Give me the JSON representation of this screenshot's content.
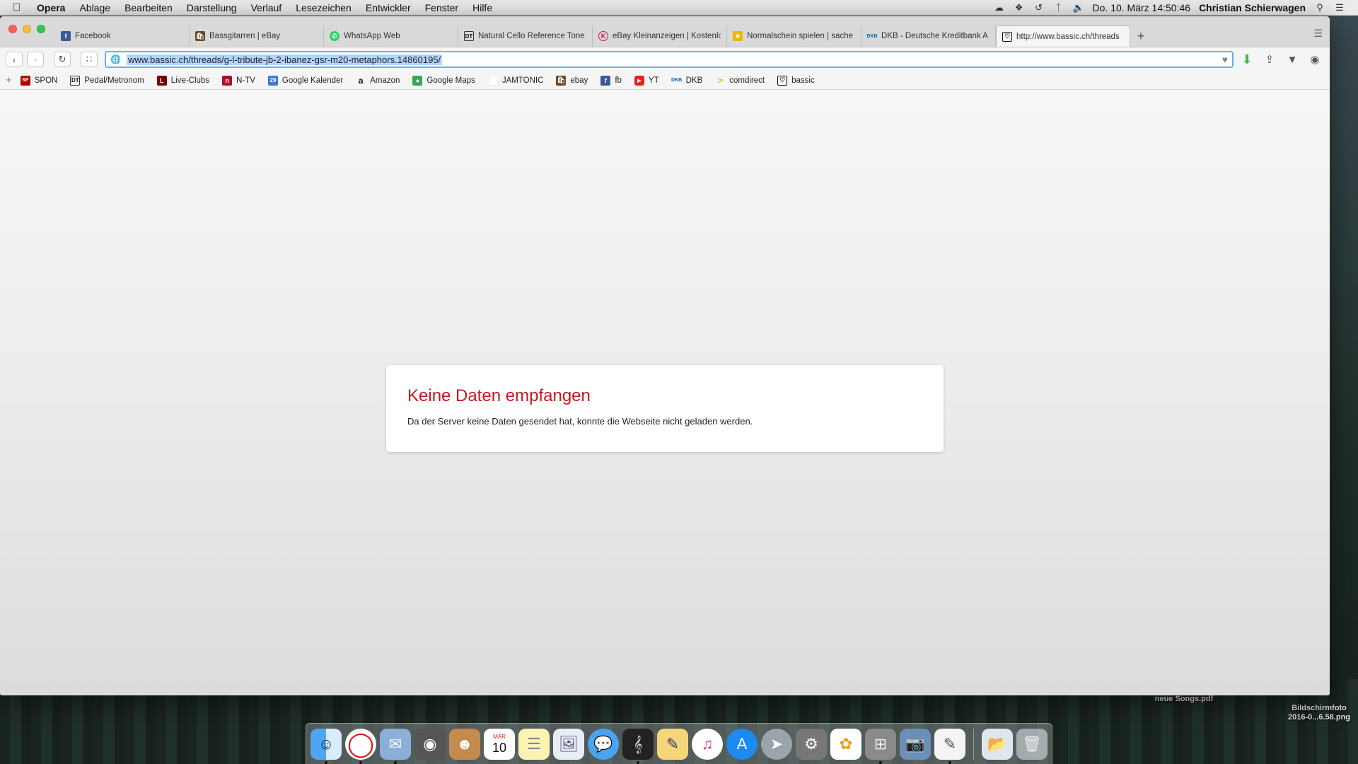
{
  "menubar": {
    "app": "Opera",
    "items": [
      "Ablage",
      "Bearbeiten",
      "Darstellung",
      "Verlauf",
      "Lesezeichen",
      "Entwickler",
      "Fenster",
      "Hilfe"
    ],
    "clock": "Do. 10. März  14:50:46",
    "user": "Christian Schierwagen"
  },
  "tabs": [
    {
      "label": "Facebook",
      "fav": "f",
      "fav_color": "#3b5998"
    },
    {
      "label": "Bassgitarren | eBay",
      "fav": "",
      "fav_color": "#6a4a2a"
    },
    {
      "label": "WhatsApp Web",
      "fav": "",
      "fav_color": "#25d366"
    },
    {
      "label": "Natural Cello Reference Tone",
      "fav": "DT",
      "fav_color": "#ffffff"
    },
    {
      "label": "eBay Kleinanzeigen | Kostenlo",
      "fav": "K",
      "fav_color": "#ffffff"
    },
    {
      "label": "Normalschein spielen | sache",
      "fav": "",
      "fav_color": "#f0b400"
    },
    {
      "label": "DKB - Deutsche Kreditbank A",
      "fav": "DKB",
      "fav_color": "#ffffff"
    },
    {
      "label": "http://www.bassic.ch/threads",
      "fav": "",
      "fav_color": "#ffffff"
    }
  ],
  "address": {
    "url": "www.bassic.ch/threads/g-l-tribute-jb-2-ibanez-gsr-m20-metaphors.14860195/"
  },
  "bookmarks": [
    {
      "label": "SPON",
      "icon": "SP",
      "color": "#b50000"
    },
    {
      "label": "Pedal/Metronom",
      "icon": "DT",
      "color": "#ffffff"
    },
    {
      "label": "Live-Clubs",
      "icon": "L",
      "color": "#7a0000"
    },
    {
      "label": "N-TV",
      "icon": "n",
      "color": "#b0102a"
    },
    {
      "label": "Google Kalender",
      "icon": "29",
      "color": "#3a78d8"
    },
    {
      "label": "Amazon",
      "icon": "a",
      "color": "#ffffff"
    },
    {
      "label": "Google Maps",
      "icon": "",
      "color": "#3aa757"
    },
    {
      "label": "JAMTONIC",
      "icon": "",
      "color": "#ffffff"
    },
    {
      "label": "ebay",
      "icon": "",
      "color": "#6a4a2a"
    },
    {
      "label": "fb",
      "icon": "f",
      "color": "#3b5998"
    },
    {
      "label": "YT",
      "icon": "▶",
      "color": "#e62117"
    },
    {
      "label": "DKB",
      "icon": "DKB",
      "color": "#ffffff"
    },
    {
      "label": "comdirect",
      "icon": ">",
      "color": "#ffffff"
    },
    {
      "label": "bassic",
      "icon": "",
      "color": "#ffffff"
    }
  ],
  "error": {
    "title": "Keine Daten empfangen",
    "message": "Da der Server keine Daten gesendet hat, konnte die Webseite nicht geladen werden."
  },
  "desktop": {
    "files": [
      {
        "label": "neue Songs.pdf"
      },
      {
        "label": "Bildschirmfoto\n2016-0...6.58.png"
      }
    ]
  },
  "dock": {
    "calendar_month": "MÄR",
    "calendar_day": "10"
  },
  "colors": {
    "error_red": "#c8171f",
    "address_focus": "#63b1f0",
    "selection": "#b3d4fc"
  }
}
